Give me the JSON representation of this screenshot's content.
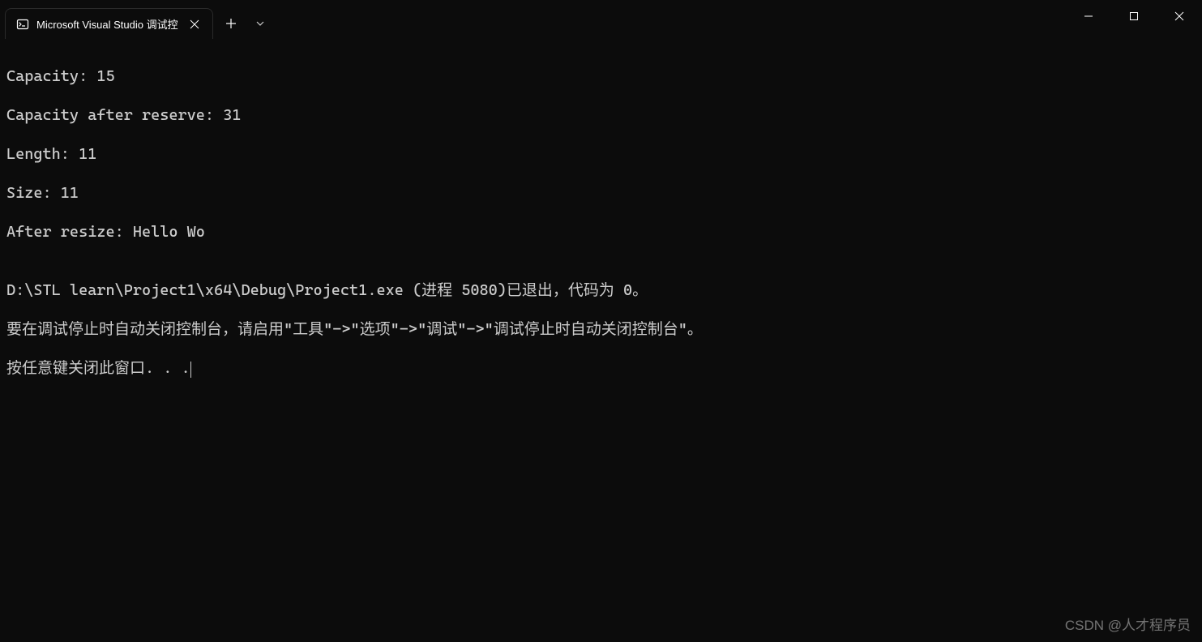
{
  "titlebar": {
    "tab": {
      "title": "Microsoft Visual Studio 调试控",
      "icon_name": "terminal-icon"
    },
    "new_tab_label": "+",
    "dropdown_icon": "chevron-down"
  },
  "window_controls": {
    "minimize": "minimize",
    "maximize": "maximize",
    "close": "close"
  },
  "console": {
    "lines": [
      "Capacity: 15",
      "Capacity after reserve: 31",
      "Length: 11",
      "Size: 11",
      "After resize: Hello Wo",
      "",
      "D:\\STL learn\\Project1\\x64\\Debug\\Project1.exe (进程 5080)已退出，代码为 0。",
      "要在调试停止时自动关闭控制台，请启用\"工具\"->\"选项\"->\"调试\"->\"调试停止时自动关闭控制台\"。",
      "按任意键关闭此窗口. . ."
    ]
  },
  "watermark": "CSDN @人才程序员"
}
